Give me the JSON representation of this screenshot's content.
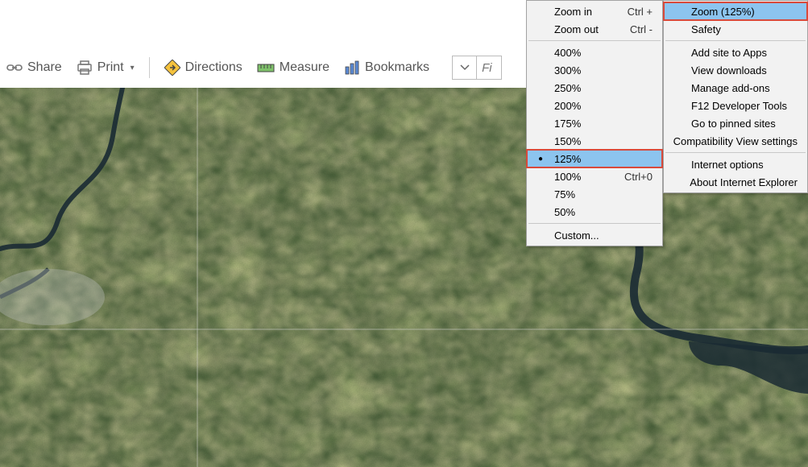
{
  "toolbar": {
    "share_label": "Share",
    "print_label": "Print",
    "directions_label": "Directions",
    "measure_label": "Measure",
    "bookmarks_label": "Bookmarks",
    "search_placeholder": "Fi"
  },
  "zoom_menu": {
    "zoom_in": {
      "label": "Zoom in",
      "accel": "Ctrl +"
    },
    "zoom_out": {
      "label": "Zoom out",
      "accel": "Ctrl -"
    },
    "levels": {
      "p400": "400%",
      "p300": "300%",
      "p250": "250%",
      "p200": "200%",
      "p175": "175%",
      "p150": "150%",
      "p125": "125%",
      "p100": "100%",
      "p75": "75%",
      "p50": "50%"
    },
    "p100_accel": "Ctrl+0",
    "custom": "Custom..."
  },
  "tools_menu": {
    "zoom_current": "Zoom (125%)",
    "safety": "Safety",
    "add_site": "Add site to Apps",
    "view_downloads": "View downloads",
    "manage_addons": "Manage add-ons",
    "f12": "F12 Developer Tools",
    "pinned": "Go to pinned sites",
    "compat": "Compatibility View settings",
    "internet_options": "Internet options",
    "about": "About Internet Explorer"
  }
}
